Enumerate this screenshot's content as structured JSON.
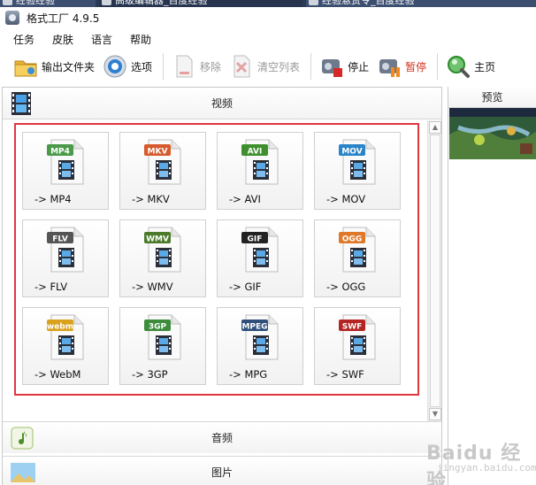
{
  "browser_tabs": [
    "经验经验",
    "高级编辑器_百度经验",
    "经验悬赏令_百度经验"
  ],
  "window": {
    "title": "格式工厂 4.9.5"
  },
  "menu": [
    "任务",
    "皮肤",
    "语言",
    "帮助"
  ],
  "toolbar": {
    "output_folder": "输出文件夹",
    "options": "选项",
    "remove": "移除",
    "clear_list": "清空列表",
    "stop": "停止",
    "pause": "暂停",
    "home": "主页"
  },
  "categories": {
    "video": "视频",
    "audio": "音频",
    "image": "图片"
  },
  "formats": [
    {
      "label": "-> MP4",
      "badge": "MP4",
      "badge_color": "#4a9a4a",
      "icon": "mp4-film-reel-icon"
    },
    {
      "label": "-> MKV",
      "badge": "MKV",
      "badge_color": "#d65a2c",
      "icon": "mkv-film-icon"
    },
    {
      "label": "-> AVI",
      "badge": "AVI",
      "badge_color": "#3f8f2f",
      "icon": "avi-film-icon"
    },
    {
      "label": "-> MOV",
      "badge": "MOV",
      "badge_color": "#2a84c8",
      "icon": "mov-quicktime-icon"
    },
    {
      "label": "-> FLV",
      "badge": "FLV",
      "badge_color": "#555555",
      "icon": "flv-clapper-icon"
    },
    {
      "label": "-> WMV",
      "badge": "WMV",
      "badge_color": "#4b7a2a",
      "icon": "wmv-camera-icon"
    },
    {
      "label": "-> GIF",
      "badge": "GIF",
      "badge_color": "#222222",
      "icon": "gif-picture-icon"
    },
    {
      "label": "-> OGG",
      "badge": "OGG",
      "badge_color": "#e0782a",
      "icon": "ogg-film-icon"
    },
    {
      "label": "-> WebM",
      "badge": "webm",
      "badge_color": "#d9a21e",
      "icon": "webm-film-icon"
    },
    {
      "label": "-> 3GP",
      "badge": "3GP",
      "badge_color": "#3c8c3c",
      "icon": "3gp-phone-icon"
    },
    {
      "label": "-> MPG",
      "badge": "MPEG",
      "badge_color": "#2f4f7a",
      "icon": "mpg-film-reel-icon"
    },
    {
      "label": "-> SWF",
      "badge": "SWF",
      "badge_color": "#b52424",
      "icon": "swf-flash-icon"
    }
  ],
  "preview": {
    "title": "预览"
  },
  "watermark": {
    "text": "Baidu 经验",
    "sub": "jingyan.baidu.com"
  }
}
